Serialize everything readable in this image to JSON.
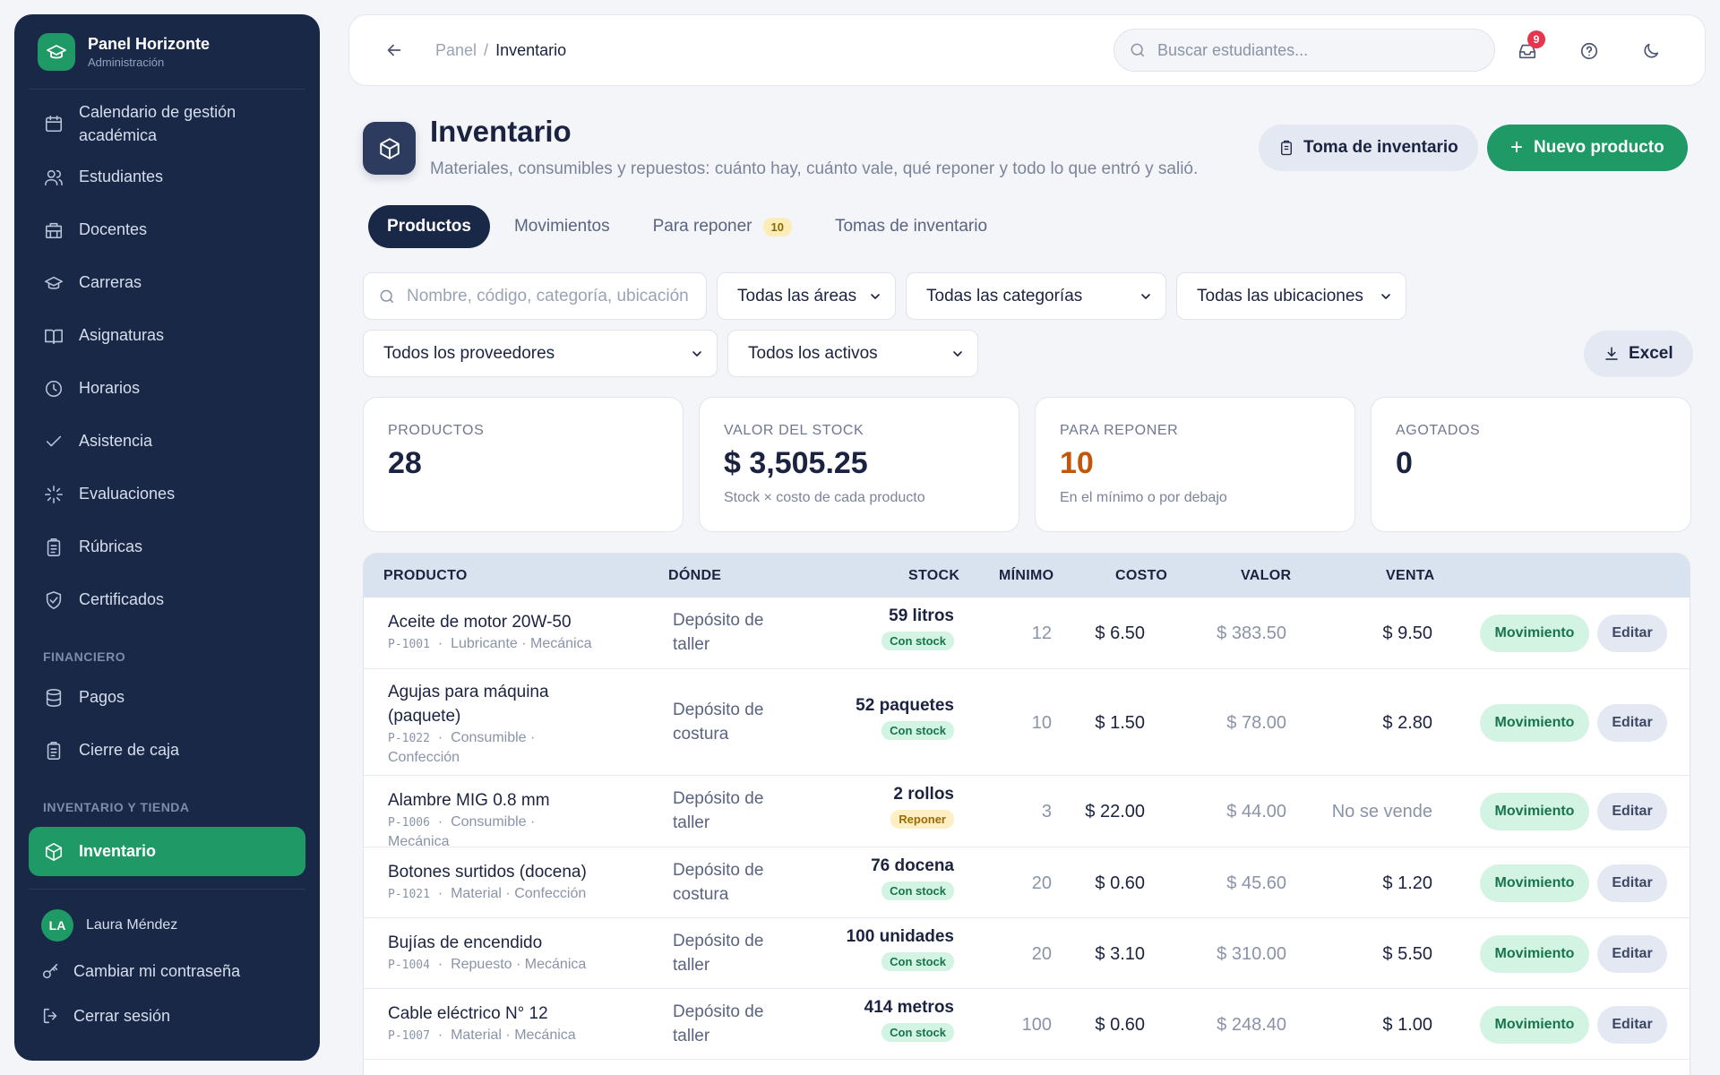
{
  "brand": {
    "title": "Panel Horizonte",
    "subtitle": "Administración"
  },
  "sidebar": {
    "items": [
      {
        "label": "Calendario de gestión académica",
        "icon": "calendar-icon"
      },
      {
        "label": "Estudiantes",
        "icon": "users-icon"
      },
      {
        "label": "Docentes",
        "icon": "building-icon"
      },
      {
        "label": "Carreras",
        "icon": "graduation-cap-icon"
      },
      {
        "label": "Asignaturas",
        "icon": "book-open-icon"
      },
      {
        "label": "Horarios",
        "icon": "clock-icon"
      },
      {
        "label": "Asistencia",
        "icon": "check-icon"
      },
      {
        "label": "Evaluaciones",
        "icon": "sparkle-icon"
      },
      {
        "label": "Rúbricas",
        "icon": "clipboard-icon"
      },
      {
        "label": "Certificados",
        "icon": "shield-check-icon"
      }
    ],
    "section_financiero": "FINANCIERO",
    "financiero": [
      {
        "label": "Pagos",
        "icon": "database-icon"
      },
      {
        "label": "Cierre de caja",
        "icon": "clipboard-icon"
      }
    ],
    "section_inventario": "INVENTARIO Y TIENDA",
    "inventario": [
      {
        "label": "Inventario",
        "icon": "box-icon",
        "active": true
      }
    ],
    "user": {
      "initials": "LA",
      "name": "Laura Méndez"
    },
    "change_password": "Cambiar mi contraseña",
    "logout": "Cerrar sesión"
  },
  "topbar": {
    "breadcrumb_parent": "Panel",
    "breadcrumb_sep": "/",
    "breadcrumb_current": "Inventario",
    "search_placeholder": "Buscar estudiantes...",
    "notifications_count": "9"
  },
  "header": {
    "title": "Inventario",
    "subtitle": "Materiales, consumibles y repuestos: cuánto hay, cuánto vale, qué reponer y todo lo que entró y salió.",
    "btn_count": "Toma de inventario",
    "btn_new": "Nuevo producto"
  },
  "tabs": [
    {
      "label": "Productos",
      "active": true
    },
    {
      "label": "Movimientos"
    },
    {
      "label": "Para reponer",
      "badge": "10"
    },
    {
      "label": "Tomas de inventario"
    }
  ],
  "filters": {
    "search_placeholder": "Nombre, código, categoría, ubicación",
    "area": "Todas las áreas",
    "category": "Todas las categorías",
    "location": "Todas las ubicaciones",
    "supplier": "Todos los proveedores",
    "assets": "Todos los activos",
    "export_label": "Excel"
  },
  "stats": [
    {
      "label": "PRODUCTOS",
      "value": "28",
      "note": ""
    },
    {
      "label": "VALOR DEL STOCK",
      "value": "$ 3,505.25",
      "note": "Stock × costo de cada producto"
    },
    {
      "label": "PARA REPONER",
      "value": "10",
      "note": "En el mínimo o por debajo",
      "warn": true
    },
    {
      "label": "AGOTADOS",
      "value": "0",
      "note": ""
    }
  ],
  "table": {
    "headers": {
      "product": "PRODUCTO",
      "where": "DÓNDE",
      "stock": "STOCK",
      "min": "MÍNIMO",
      "cost": "COSTO",
      "value": "VALOR",
      "sale": "VENTA"
    },
    "btn_move": "Movimiento",
    "btn_edit": "Editar",
    "rows": [
      {
        "name": "Aceite de motor 20W-50",
        "code": "P-1001",
        "meta": "Lubricante · Mecánica",
        "where": "Depósito de taller",
        "stock": "59 litros",
        "status": "Con stock",
        "min": "12",
        "cost": "$ 6.50",
        "value": "$ 383.50",
        "sale": "$ 9.50"
      },
      {
        "name": "Agujas para máquina (paquete)",
        "code": "P-1022",
        "meta": "Consumible · Confección",
        "where": "Depósito de costura",
        "stock": "52 paquetes",
        "status": "Con stock",
        "min": "10",
        "cost": "$ 1.50",
        "value": "$ 78.00",
        "sale": "$ 2.80"
      },
      {
        "name": "Alambre MIG 0.8 mm",
        "code": "P-1006",
        "meta": "Consumible · Mecánica",
        "where": "Depósito de taller",
        "stock": "2 rollos",
        "status": "Reponer",
        "min": "3",
        "cost": "$ 22.00",
        "value": "$ 44.00",
        "sale": "No se vende"
      },
      {
        "name": "Botones surtidos (docena)",
        "code": "P-1021",
        "meta": "Material · Confección",
        "where": "Depósito de costura",
        "stock": "76 docena",
        "status": "Con stock",
        "min": "20",
        "cost": "$ 0.60",
        "value": "$ 45.60",
        "sale": "$ 1.20"
      },
      {
        "name": "Bujías de encendido",
        "code": "P-1004",
        "meta": "Repuesto · Mecánica",
        "where": "Depósito de taller",
        "stock": "100 unidades",
        "status": "Con stock",
        "min": "20",
        "cost": "$ 3.10",
        "value": "$ 310.00",
        "sale": "$ 5.50"
      },
      {
        "name": "Cable eléctrico N° 12",
        "code": "P-1007",
        "meta": "Material · Mecánica",
        "where": "Depósito de taller",
        "stock": "414 metros",
        "status": "Con stock",
        "min": "100",
        "cost": "$ 0.60",
        "value": "$ 248.40",
        "sale": "$ 1.00"
      }
    ]
  }
}
